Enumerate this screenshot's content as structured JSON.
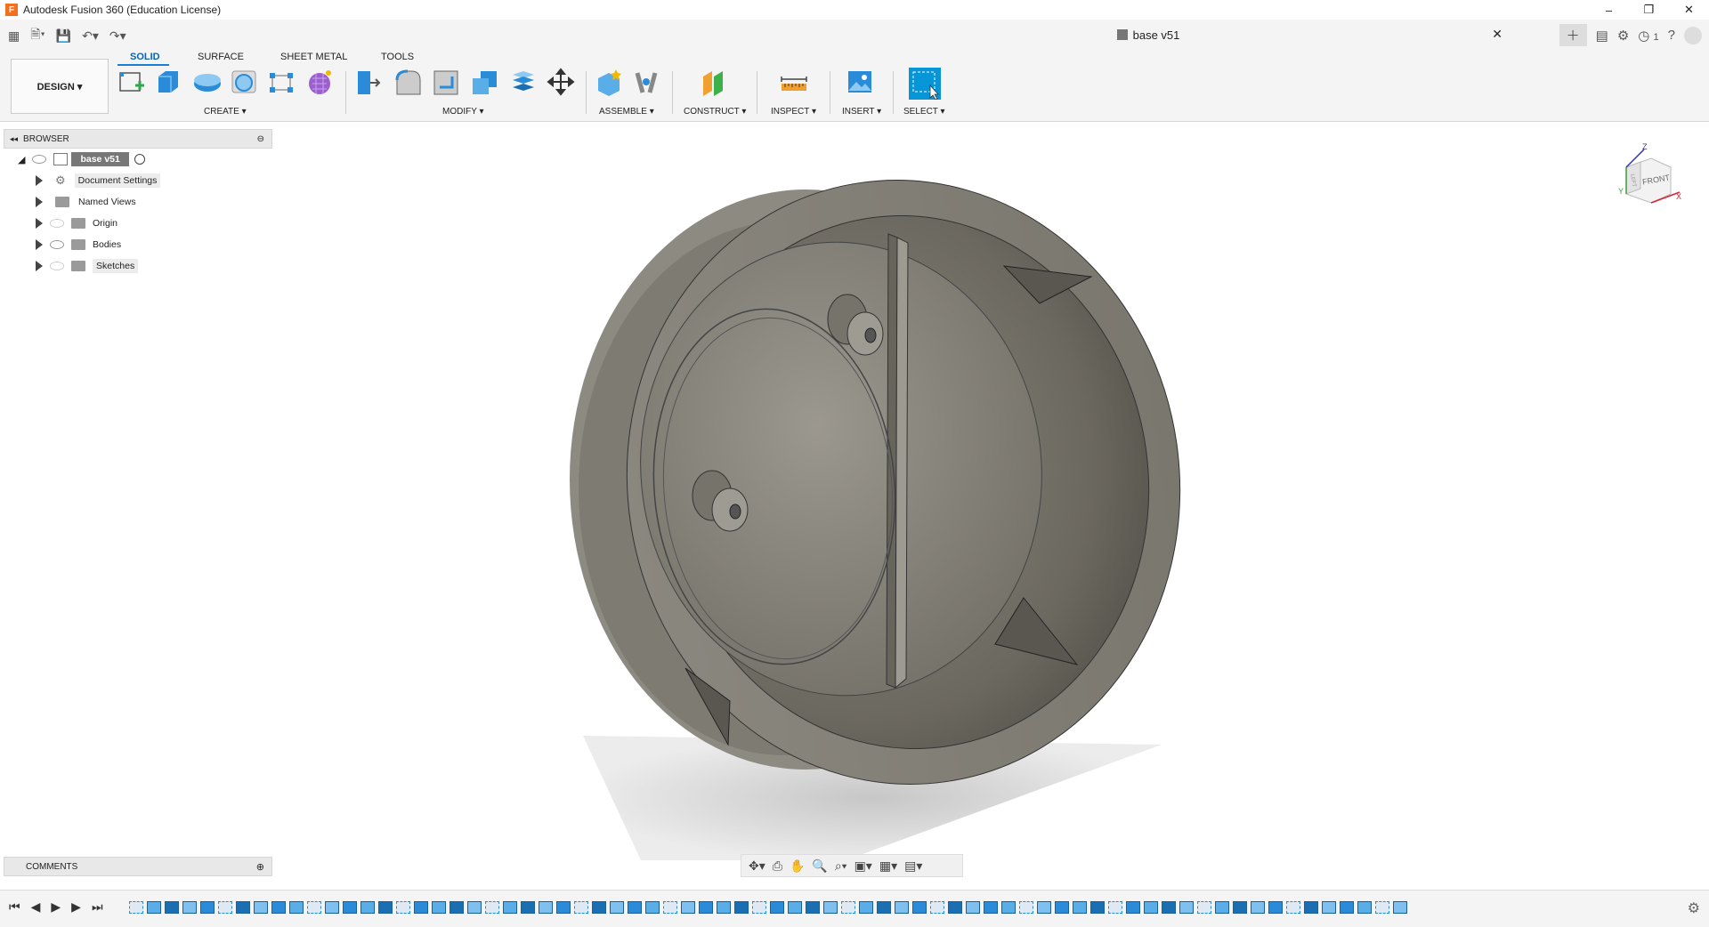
{
  "window": {
    "title": "Autodesk Fusion 360 (Education License)",
    "app_icon_letter": "F",
    "minimize": "–",
    "restore": "❐",
    "close": "✕"
  },
  "doc_tab": {
    "title": "base v51",
    "close": "✕"
  },
  "top_right": {
    "job_count": "1"
  },
  "workspace": {
    "label": "DESIGN ▾"
  },
  "toolbar_tabs": [
    "SOLID",
    "SURFACE",
    "SHEET METAL",
    "TOOLS"
  ],
  "groups": {
    "create": "CREATE ▾",
    "modify": "MODIFY ▾",
    "assemble": "ASSEMBLE ▾",
    "construct": "CONSTRUCT ▾",
    "inspect": "INSPECT ▾",
    "insert": "INSERT ▾",
    "select": "SELECT ▾"
  },
  "browser": {
    "title": "BROWSER",
    "root": "base v51",
    "items": [
      "Document Settings",
      "Named Views",
      "Origin",
      "Bodies",
      "Sketches"
    ]
  },
  "comments": {
    "title": "COMMENTS"
  },
  "viewcube": {
    "face": "FRONT",
    "side": "LEFT",
    "axis_z": "Z",
    "axis_x": "X",
    "axis_y": "Y"
  },
  "colors": {
    "accent": "#0696d7",
    "model": "#7d7a72",
    "toolbar_bg": "#f4f4f4"
  }
}
